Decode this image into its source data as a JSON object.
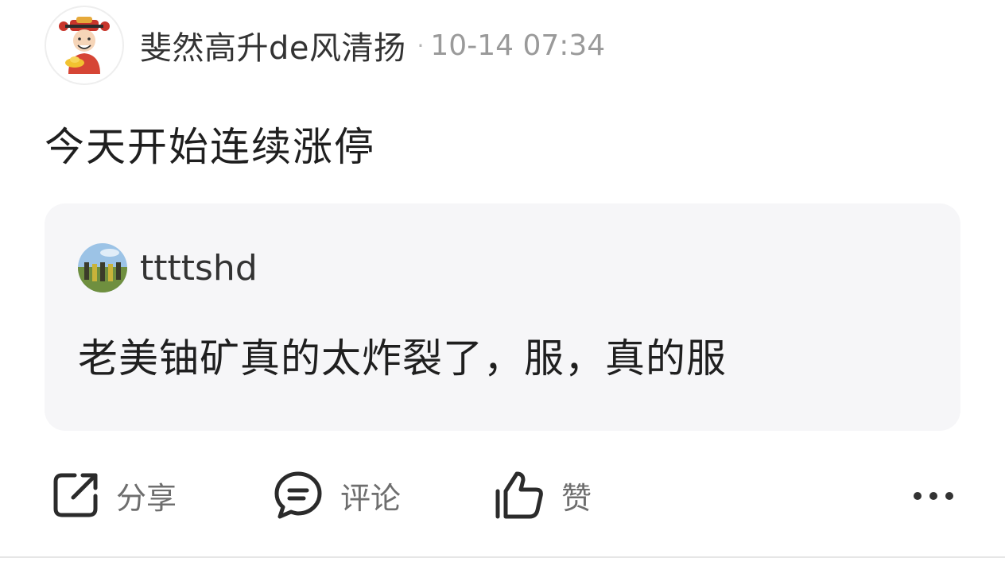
{
  "post": {
    "author": {
      "name": "斐然高升de风清扬",
      "avatar_icon": "fortune-god-avatar"
    },
    "separator": "·",
    "timestamp": "10-14 07:34",
    "text": "今天开始连续涨停"
  },
  "quote": {
    "author": {
      "name": "ttttshd",
      "avatar_icon": "outdoor-photo-avatar"
    },
    "text": "老美铀矿真的太炸裂了，服，真的服"
  },
  "actions": {
    "share": {
      "label": "分享",
      "icon": "share-icon"
    },
    "comment": {
      "label": "评论",
      "icon": "comment-icon"
    },
    "like": {
      "label": "赞",
      "icon": "thumbs-up-icon"
    },
    "more": {
      "icon": "more-icon"
    }
  },
  "colors": {
    "text_primary": "#1f1f1f",
    "text_secondary": "#9a9a9a",
    "action_gray": "#6e6e6e",
    "quote_bg": "#f6f6f8"
  }
}
